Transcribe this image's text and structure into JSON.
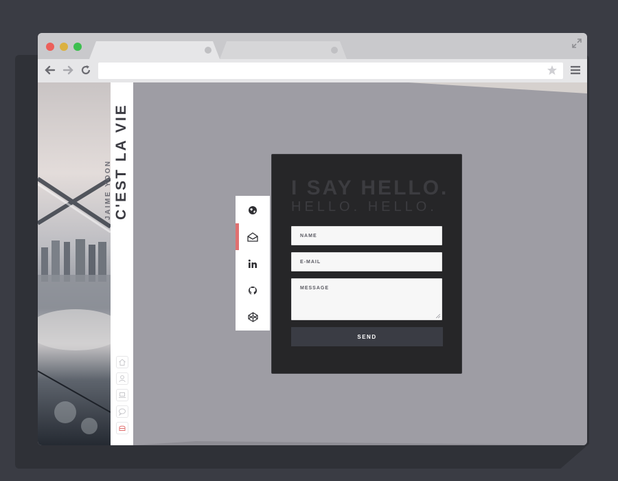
{
  "browser": {
    "controls": {
      "close_color": "#ec5f5a",
      "minimize_color": "#dbb13f",
      "maximize_color": "#3dbf4f"
    },
    "tabs": [
      {
        "label": "",
        "active": true
      },
      {
        "label": "",
        "active": false
      }
    ],
    "address": {
      "url": ""
    },
    "icons": {
      "back": "arrow-left-icon",
      "forward": "arrow-right-icon",
      "reload": "reload-icon",
      "bookmark": "star-icon",
      "menu": "hamburger-menu-icon",
      "fullscreen": "expand-icon"
    }
  },
  "sidebar": {
    "title": "C'EST LA VIE",
    "subtitle": "JAIME YOON",
    "nav_icons": [
      {
        "name": "home-icon",
        "active": false
      },
      {
        "name": "user-icon",
        "active": false
      },
      {
        "name": "laptop-icon",
        "active": false
      },
      {
        "name": "chat-icon",
        "active": false
      },
      {
        "name": "mailbox-icon",
        "active": true
      }
    ]
  },
  "social": {
    "items": [
      {
        "name": "globe-icon",
        "active": false
      },
      {
        "name": "envelope-icon",
        "active": true
      },
      {
        "name": "linkedin-icon",
        "active": false
      },
      {
        "name": "github-icon",
        "active": false
      },
      {
        "name": "codepen-icon",
        "active": false
      }
    ],
    "active_color": "#e07070"
  },
  "contact": {
    "heading": "I SAY HELLO.",
    "subheading": "HELLO. HELLO.",
    "name_placeholder": "NAME",
    "email_placeholder": "E-MAIL",
    "message_placeholder": "MESSAGE",
    "send_label": "SEND"
  },
  "colors": {
    "page_background": "#9e9da4",
    "card_background": "#262628",
    "button_background": "#3a3c44",
    "accent": "#e07070"
  }
}
